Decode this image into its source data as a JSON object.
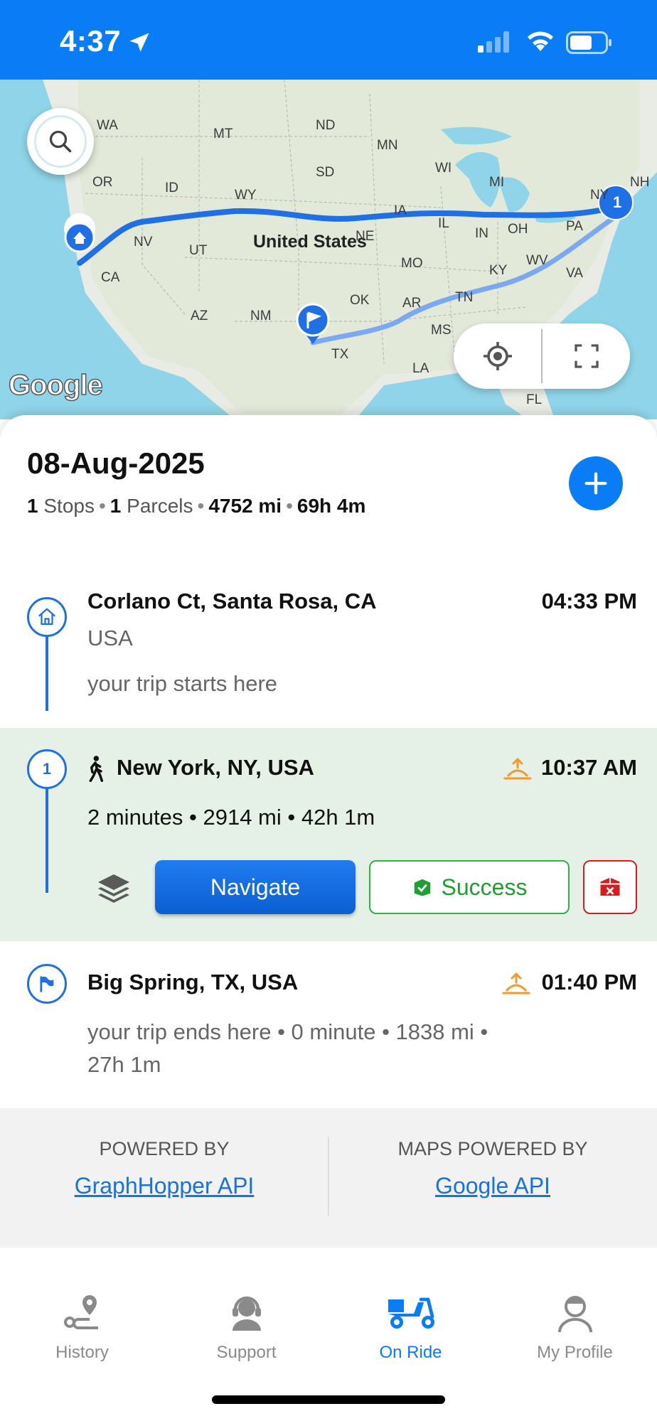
{
  "status_bar": {
    "time": "4:37"
  },
  "map": {
    "country_label": "United States",
    "state_labels": [
      "WA",
      "MT",
      "ND",
      "MN",
      "OR",
      "ID",
      "SD",
      "WY",
      "WI",
      "MI",
      "NY",
      "NH",
      "NV",
      "UT",
      "IA",
      "IL",
      "IN",
      "OH",
      "PA",
      "CA",
      "NE",
      "MO",
      "KY",
      "WV",
      "VA",
      "AZ",
      "NM",
      "OK",
      "AR",
      "TN",
      "MS",
      "TX",
      "LA",
      "FL"
    ],
    "marker_number": "1",
    "attribution": "Google"
  },
  "trip": {
    "date": "08-Aug-2025",
    "summary": {
      "stops_count": "1",
      "stops_label": "Stops",
      "parcels_count": "1",
      "parcels_label": "Parcels",
      "distance": "4752 mi",
      "duration": "69h 4m"
    }
  },
  "stops": {
    "start": {
      "title": "Corlano Ct, Santa Rosa, CA",
      "country": "USA",
      "note": "your trip starts here",
      "time": "04:33 PM"
    },
    "stop1": {
      "number": "1",
      "title": "New York, NY, USA",
      "time": "10:37 AM",
      "details": "2 minutes • 2914 mi • 42h 1m",
      "navigate_label": "Navigate",
      "success_label": "Success"
    },
    "end": {
      "title": "Big Spring, TX, USA",
      "time": "01:40 PM",
      "note_line1": "your trip ends here • 0 minute • 1838 mi •",
      "note_line2": "27h 1m"
    }
  },
  "powered": {
    "left_caption": "POWERED BY",
    "left_link": "GraphHopper API",
    "right_caption": "MAPS POWERED BY",
    "right_link": "Google API"
  },
  "tabs": [
    {
      "label": "History",
      "icon": "route-icon"
    },
    {
      "label": "Support",
      "icon": "headset-icon"
    },
    {
      "label": "On Ride",
      "icon": "scooter-icon"
    },
    {
      "label": "My Profile",
      "icon": "profile-icon"
    }
  ],
  "colors": {
    "accent": "#0a7cf6",
    "success": "#2db53f",
    "danger": "#d81c1c",
    "active_row": "#e5f1e6"
  }
}
